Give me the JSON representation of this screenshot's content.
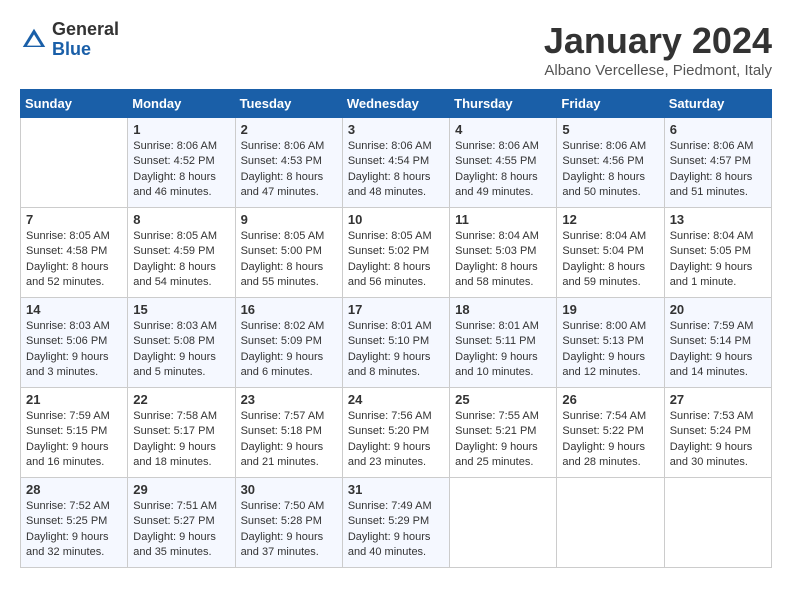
{
  "header": {
    "logo_general": "General",
    "logo_blue": "Blue",
    "title": "January 2024",
    "location": "Albano Vercellese, Piedmont, Italy"
  },
  "weekdays": [
    "Sunday",
    "Monday",
    "Tuesday",
    "Wednesday",
    "Thursday",
    "Friday",
    "Saturday"
  ],
  "weeks": [
    [
      {
        "day": "",
        "info": ""
      },
      {
        "day": "1",
        "info": "Sunrise: 8:06 AM\nSunset: 4:52 PM\nDaylight: 8 hours\nand 46 minutes."
      },
      {
        "day": "2",
        "info": "Sunrise: 8:06 AM\nSunset: 4:53 PM\nDaylight: 8 hours\nand 47 minutes."
      },
      {
        "day": "3",
        "info": "Sunrise: 8:06 AM\nSunset: 4:54 PM\nDaylight: 8 hours\nand 48 minutes."
      },
      {
        "day": "4",
        "info": "Sunrise: 8:06 AM\nSunset: 4:55 PM\nDaylight: 8 hours\nand 49 minutes."
      },
      {
        "day": "5",
        "info": "Sunrise: 8:06 AM\nSunset: 4:56 PM\nDaylight: 8 hours\nand 50 minutes."
      },
      {
        "day": "6",
        "info": "Sunrise: 8:06 AM\nSunset: 4:57 PM\nDaylight: 8 hours\nand 51 minutes."
      }
    ],
    [
      {
        "day": "7",
        "info": "Sunrise: 8:05 AM\nSunset: 4:58 PM\nDaylight: 8 hours\nand 52 minutes."
      },
      {
        "day": "8",
        "info": "Sunrise: 8:05 AM\nSunset: 4:59 PM\nDaylight: 8 hours\nand 54 minutes."
      },
      {
        "day": "9",
        "info": "Sunrise: 8:05 AM\nSunset: 5:00 PM\nDaylight: 8 hours\nand 55 minutes."
      },
      {
        "day": "10",
        "info": "Sunrise: 8:05 AM\nSunset: 5:02 PM\nDaylight: 8 hours\nand 56 minutes."
      },
      {
        "day": "11",
        "info": "Sunrise: 8:04 AM\nSunset: 5:03 PM\nDaylight: 8 hours\nand 58 minutes."
      },
      {
        "day": "12",
        "info": "Sunrise: 8:04 AM\nSunset: 5:04 PM\nDaylight: 8 hours\nand 59 minutes."
      },
      {
        "day": "13",
        "info": "Sunrise: 8:04 AM\nSunset: 5:05 PM\nDaylight: 9 hours\nand 1 minute."
      }
    ],
    [
      {
        "day": "14",
        "info": "Sunrise: 8:03 AM\nSunset: 5:06 PM\nDaylight: 9 hours\nand 3 minutes."
      },
      {
        "day": "15",
        "info": "Sunrise: 8:03 AM\nSunset: 5:08 PM\nDaylight: 9 hours\nand 5 minutes."
      },
      {
        "day": "16",
        "info": "Sunrise: 8:02 AM\nSunset: 5:09 PM\nDaylight: 9 hours\nand 6 minutes."
      },
      {
        "day": "17",
        "info": "Sunrise: 8:01 AM\nSunset: 5:10 PM\nDaylight: 9 hours\nand 8 minutes."
      },
      {
        "day": "18",
        "info": "Sunrise: 8:01 AM\nSunset: 5:11 PM\nDaylight: 9 hours\nand 10 minutes."
      },
      {
        "day": "19",
        "info": "Sunrise: 8:00 AM\nSunset: 5:13 PM\nDaylight: 9 hours\nand 12 minutes."
      },
      {
        "day": "20",
        "info": "Sunrise: 7:59 AM\nSunset: 5:14 PM\nDaylight: 9 hours\nand 14 minutes."
      }
    ],
    [
      {
        "day": "21",
        "info": "Sunrise: 7:59 AM\nSunset: 5:15 PM\nDaylight: 9 hours\nand 16 minutes."
      },
      {
        "day": "22",
        "info": "Sunrise: 7:58 AM\nSunset: 5:17 PM\nDaylight: 9 hours\nand 18 minutes."
      },
      {
        "day": "23",
        "info": "Sunrise: 7:57 AM\nSunset: 5:18 PM\nDaylight: 9 hours\nand 21 minutes."
      },
      {
        "day": "24",
        "info": "Sunrise: 7:56 AM\nSunset: 5:20 PM\nDaylight: 9 hours\nand 23 minutes."
      },
      {
        "day": "25",
        "info": "Sunrise: 7:55 AM\nSunset: 5:21 PM\nDaylight: 9 hours\nand 25 minutes."
      },
      {
        "day": "26",
        "info": "Sunrise: 7:54 AM\nSunset: 5:22 PM\nDaylight: 9 hours\nand 28 minutes."
      },
      {
        "day": "27",
        "info": "Sunrise: 7:53 AM\nSunset: 5:24 PM\nDaylight: 9 hours\nand 30 minutes."
      }
    ],
    [
      {
        "day": "28",
        "info": "Sunrise: 7:52 AM\nSunset: 5:25 PM\nDaylight: 9 hours\nand 32 minutes."
      },
      {
        "day": "29",
        "info": "Sunrise: 7:51 AM\nSunset: 5:27 PM\nDaylight: 9 hours\nand 35 minutes."
      },
      {
        "day": "30",
        "info": "Sunrise: 7:50 AM\nSunset: 5:28 PM\nDaylight: 9 hours\nand 37 minutes."
      },
      {
        "day": "31",
        "info": "Sunrise: 7:49 AM\nSunset: 5:29 PM\nDaylight: 9 hours\nand 40 minutes."
      },
      {
        "day": "",
        "info": ""
      },
      {
        "day": "",
        "info": ""
      },
      {
        "day": "",
        "info": ""
      }
    ]
  ]
}
